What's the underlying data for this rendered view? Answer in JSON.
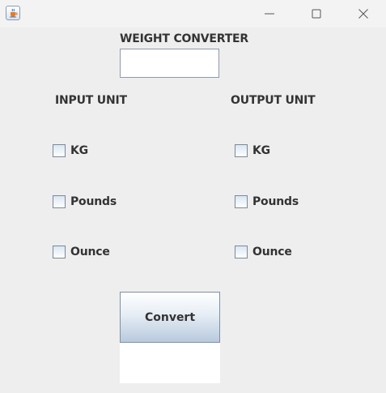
{
  "window": {
    "icon": "java-cup-icon",
    "controls": [
      "minimize-icon",
      "maximize-icon",
      "close-icon"
    ]
  },
  "form": {
    "heading": "WEIGHT CONVERTER",
    "weight_value": "",
    "input_unit_label": "INPUT UNIT",
    "output_unit_label": "OUTPUT UNIT",
    "input_units": [
      {
        "label": "KG",
        "checked": false
      },
      {
        "label": "Pounds",
        "checked": false
      },
      {
        "label": "Ounce",
        "checked": false
      }
    ],
    "output_units": [
      {
        "label": "KG",
        "checked": false
      },
      {
        "label": "Pounds",
        "checked": false
      },
      {
        "label": "Ounce",
        "checked": false
      }
    ],
    "convert_label": "Convert",
    "result": ""
  }
}
